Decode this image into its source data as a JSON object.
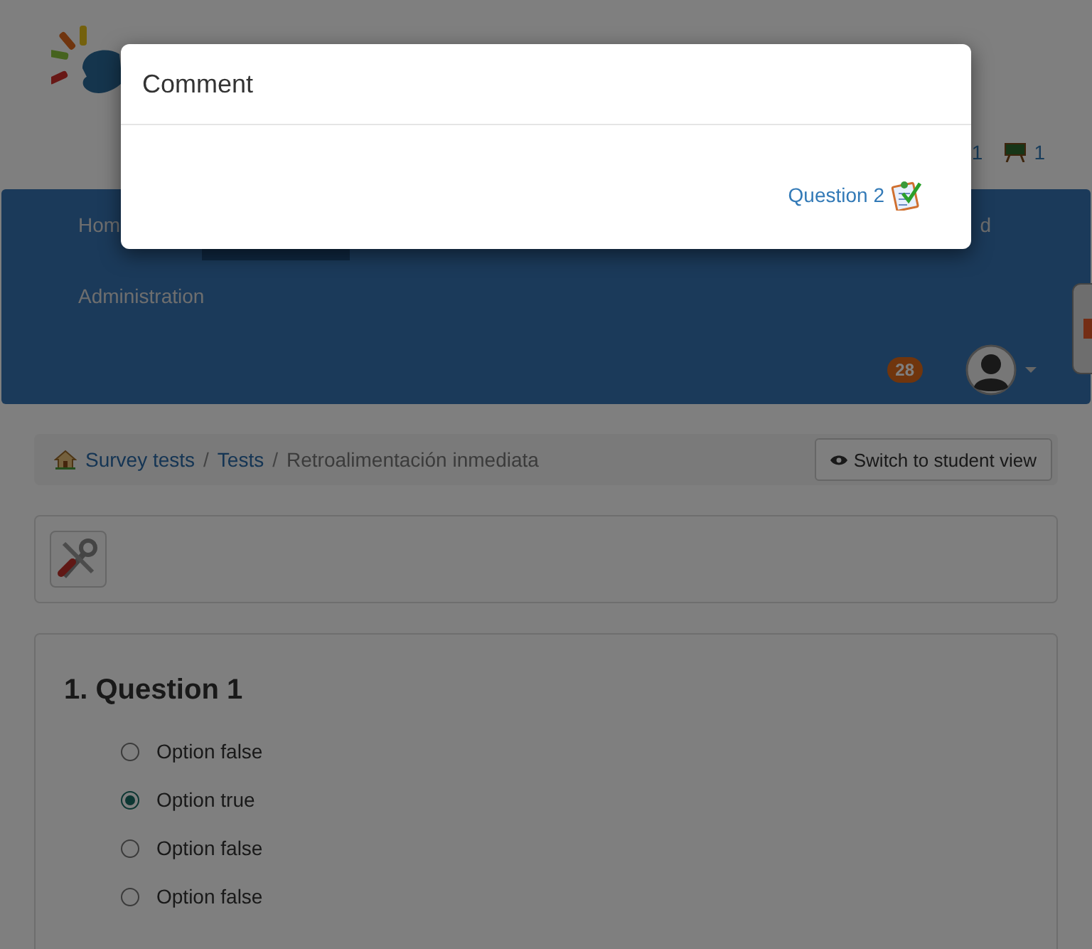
{
  "header": {
    "counters": [
      {
        "kind": "plain",
        "value": "1"
      },
      {
        "kind": "board",
        "value": "1"
      }
    ]
  },
  "nav": {
    "rows": [
      [
        {
          "label": "Hom",
          "selected": false
        },
        {
          "selected": true
        },
        {
          "label": "d",
          "selected": false
        }
      ],
      [
        {
          "label": "Administration",
          "selected": false
        }
      ]
    ],
    "badge": "28"
  },
  "breadcrumb_separator": "/",
  "breadcrumb": [
    {
      "kind": "home",
      "label": "Survey tests"
    },
    {
      "kind": "link",
      "label": "Tests"
    },
    {
      "kind": "current",
      "label": "Retroalimentación inmediata"
    }
  ],
  "student_view_button": "Switch to student view",
  "question": {
    "title": "1. Question 1",
    "options": [
      {
        "label": "Option false",
        "selected": false
      },
      {
        "label": "Option true",
        "selected": true
      },
      {
        "label": "Option false",
        "selected": false
      },
      {
        "label": "Option false",
        "selected": false
      }
    ]
  },
  "modal": {
    "title": "Comment",
    "link": "Question 2"
  }
}
